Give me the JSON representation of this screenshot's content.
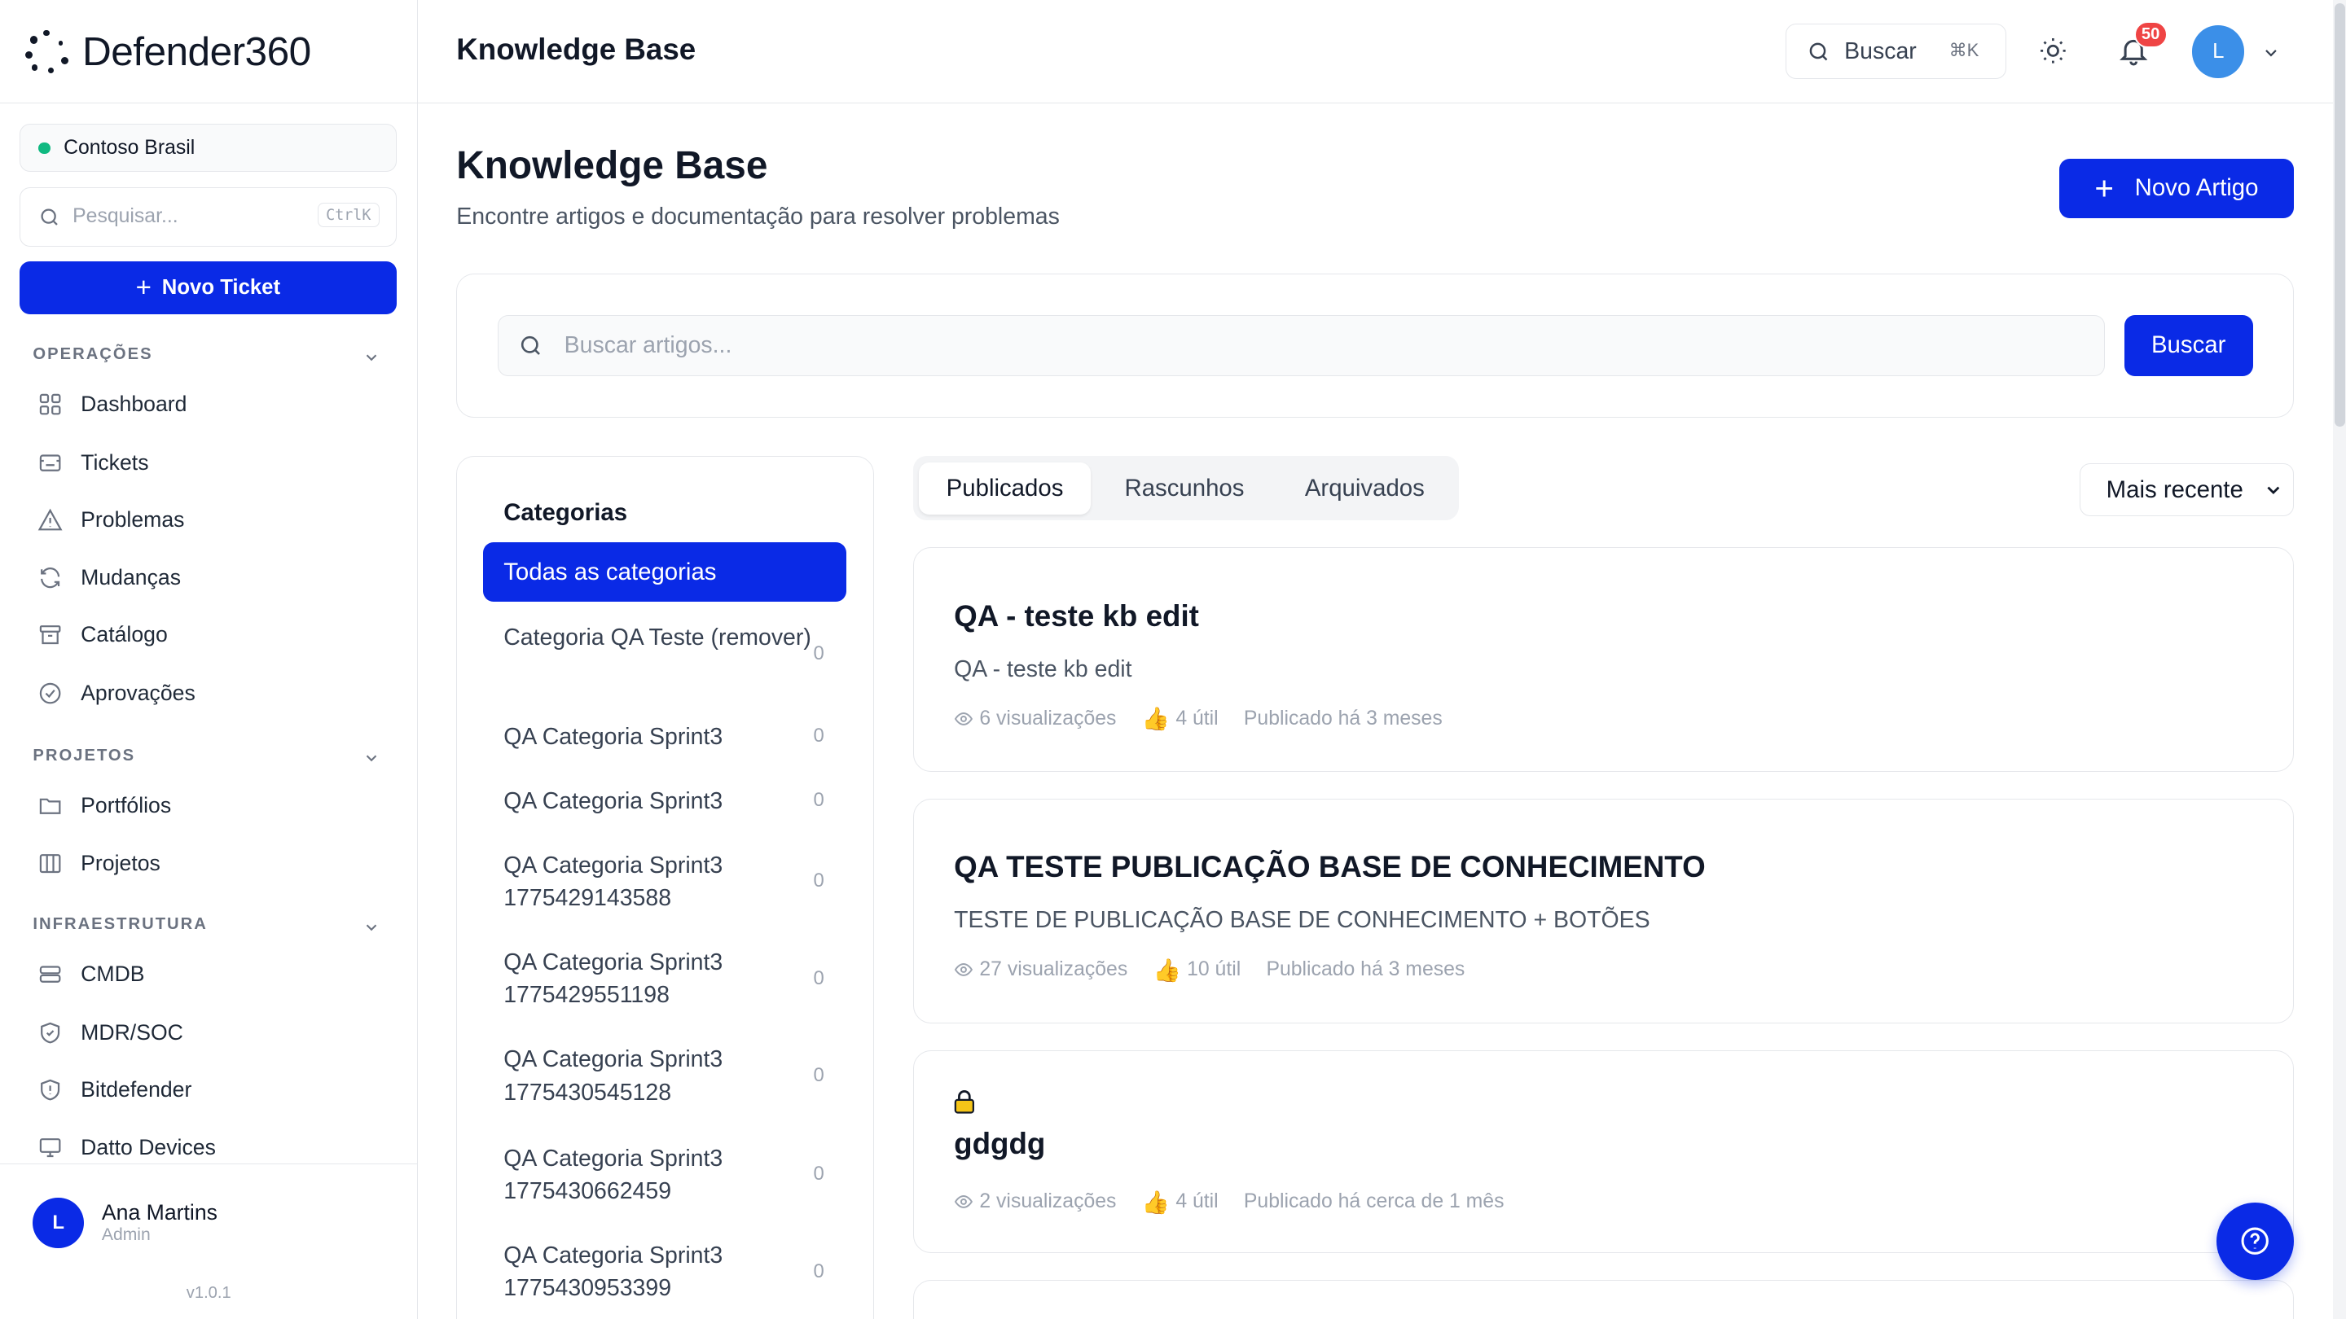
{
  "brand": {
    "name": "Defender360"
  },
  "sidebar": {
    "org": "Contoso Brasil",
    "search_placeholder": "Pesquisar...",
    "search_shortcut": "CtrlK",
    "new_ticket": "Novo Ticket",
    "sections": [
      {
        "label": "OPERAÇÕES",
        "items": [
          "Dashboard",
          "Tickets",
          "Problemas",
          "Mudanças",
          "Catálogo",
          "Aprovações"
        ]
      },
      {
        "label": "PROJETOS",
        "items": [
          "Portfólios",
          "Projetos"
        ]
      },
      {
        "label": "INFRAESTRUTURA",
        "items": [
          "CMDB",
          "MDR/SOC",
          "Bitdefender",
          "Datto Devices"
        ]
      }
    ],
    "user": {
      "initial": "L",
      "name": "Ana Martins",
      "role": "Admin"
    },
    "version": "v1.0.1"
  },
  "topbar": {
    "title": "Knowledge Base",
    "search_label": "Buscar",
    "search_shortcut": "⌘K",
    "notifications": "50",
    "avatar_initial": "L"
  },
  "main": {
    "title": "Knowledge Base",
    "subtitle": "Encontre artigos e documentação para resolver problemas",
    "new_article": "Novo Artigo",
    "search_placeholder": "Buscar artigos...",
    "search_button": "Buscar",
    "categories_title": "Categorias",
    "all_categories": "Todas as categorias",
    "categories": [
      {
        "name": "Categoria QA Teste (remover)",
        "count": "0"
      },
      {
        "name": "QA Categoria Sprint3",
        "count": "0"
      },
      {
        "name": "QA Categoria Sprint3",
        "count": "0"
      },
      {
        "name": "QA Categoria Sprint3 1775429143588",
        "count": "0"
      },
      {
        "name": "QA Categoria Sprint3 1775429551198",
        "count": "0"
      },
      {
        "name": "QA Categoria Sprint3 1775430545128",
        "count": "0"
      },
      {
        "name": "QA Categoria Sprint3 1775430662459",
        "count": "0"
      },
      {
        "name": "QA Categoria Sprint3 1775430953399",
        "count": "0"
      }
    ],
    "tabs": [
      "Publicados",
      "Rascunhos",
      "Arquivados"
    ],
    "sort": "Mais recente",
    "articles": [
      {
        "title": "QA - teste kb edit",
        "summary": "QA - teste kb edit",
        "views": "6 visualizações",
        "useful": "4 útil",
        "published": "Publicado há 3 meses"
      },
      {
        "title": "QA TESTE PUBLICAÇÃO BASE DE CONHECIMENTO",
        "summary": "TESTE DE PUBLICAÇÃO BASE DE CONHECIMENTO + BOTÕES",
        "views": "27 visualizações",
        "useful": "10 útil",
        "published": "Publicado há 3 meses"
      },
      {
        "title": "gdgdg",
        "summary": "",
        "views": "2 visualizações",
        "useful": "4 útil",
        "published": "Publicado há cerca de 1 mês"
      }
    ]
  },
  "colors": {
    "primary": "#0a2ae6",
    "status_online": "#10b981",
    "badge": "#ef4444"
  }
}
